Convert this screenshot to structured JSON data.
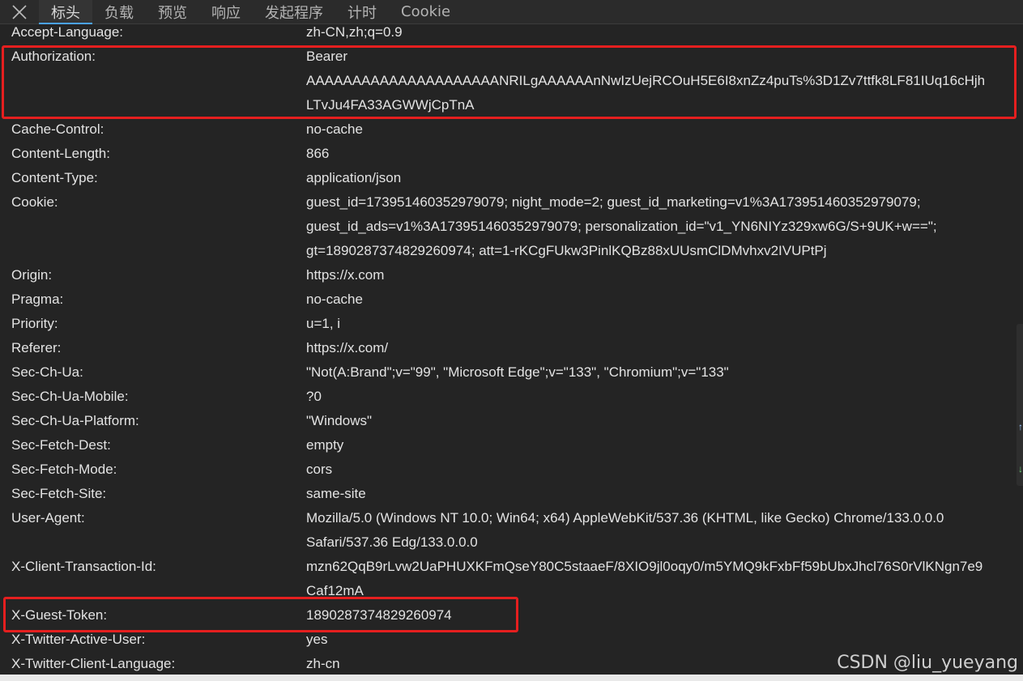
{
  "tabs": [
    {
      "label": "标头",
      "active": true
    },
    {
      "label": "负载",
      "active": false
    },
    {
      "label": "预览",
      "active": false
    },
    {
      "label": "响应",
      "active": false
    },
    {
      "label": "发起程序",
      "active": false
    },
    {
      "label": "计时",
      "active": false
    },
    {
      "label": "Cookie",
      "active": false
    }
  ],
  "headers": [
    {
      "name": "Accept-Language:",
      "value": [
        "zh-CN,zh;q=0.9"
      ]
    },
    {
      "name": "Authorization:",
      "value": [
        "Bearer",
        "AAAAAAAAAAAAAAAAAAAAANRILgAAAAAAnNwIzUejRCOuH5E6I8xnZz4puTs%3D1Zv7ttfk8LF81IUq16cHjh",
        "LTvJu4FA33AGWWjCpTnA"
      ]
    },
    {
      "name": "Cache-Control:",
      "value": [
        "no-cache"
      ]
    },
    {
      "name": "Content-Length:",
      "value": [
        "866"
      ]
    },
    {
      "name": "Content-Type:",
      "value": [
        "application/json"
      ]
    },
    {
      "name": "Cookie:",
      "value": [
        "guest_id=173951460352979079; night_mode=2; guest_id_marketing=v1%3A173951460352979079;",
        "guest_id_ads=v1%3A173951460352979079; personalization_id=\"v1_YN6NIYz329xw6G/S+9UK+w==\";",
        "gt=1890287374829260974; att=1-rKCgFUkw3PinlKQBz88xUUsmClDMvhxv2IVUPtPj"
      ]
    },
    {
      "name": "Origin:",
      "value": [
        "https://x.com"
      ]
    },
    {
      "name": "Pragma:",
      "value": [
        "no-cache"
      ]
    },
    {
      "name": "Priority:",
      "value": [
        "u=1, i"
      ]
    },
    {
      "name": "Referer:",
      "value": [
        "https://x.com/"
      ]
    },
    {
      "name": "Sec-Ch-Ua:",
      "value": [
        "\"Not(A:Brand\";v=\"99\", \"Microsoft Edge\";v=\"133\", \"Chromium\";v=\"133\""
      ]
    },
    {
      "name": "Sec-Ch-Ua-Mobile:",
      "value": [
        "?0"
      ]
    },
    {
      "name": "Sec-Ch-Ua-Platform:",
      "value": [
        "\"Windows\""
      ]
    },
    {
      "name": "Sec-Fetch-Dest:",
      "value": [
        "empty"
      ]
    },
    {
      "name": "Sec-Fetch-Mode:",
      "value": [
        "cors"
      ]
    },
    {
      "name": "Sec-Fetch-Site:",
      "value": [
        "same-site"
      ]
    },
    {
      "name": "User-Agent:",
      "value": [
        "Mozilla/5.0 (Windows NT 10.0; Win64; x64) AppleWebKit/537.36 (KHTML, like Gecko) Chrome/133.0.0.0",
        "Safari/537.36 Edg/133.0.0.0"
      ]
    },
    {
      "name": "X-Client-Transaction-Id:",
      "value": [
        "mzn62QqB9rLvw2UaPHUXKFmQseY80C5staaeF/8XIO9jl0oqy0/m5YMQ9kFxbFf59bUbxJhcl76S0rVlKNgn7e9",
        "Caf12mA"
      ]
    },
    {
      "name": "X-Guest-Token:",
      "value": [
        "1890287374829260974"
      ]
    },
    {
      "name": "X-Twitter-Active-User:",
      "value": [
        "yes"
      ]
    },
    {
      "name": "X-Twitter-Client-Language:",
      "value": [
        "zh-cn"
      ]
    }
  ],
  "watermark": "CSDN @liu_yueyang",
  "colors": {
    "background": "#242424",
    "text": "#e3e3e3",
    "highlight_border": "#e51f1f",
    "active_tab_underline": "#4aa3ff"
  }
}
